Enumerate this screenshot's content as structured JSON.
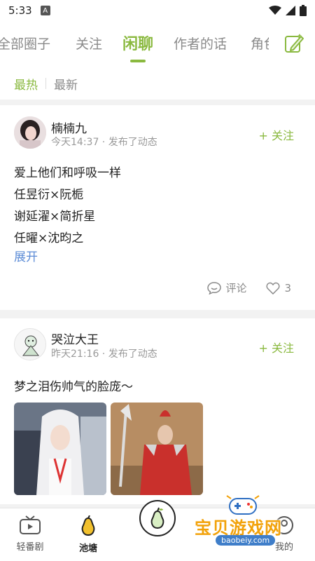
{
  "status_bar": {
    "time": "5:33",
    "badge": "A"
  },
  "tabs": [
    {
      "label": "全部圈子",
      "active": false
    },
    {
      "label": "关注",
      "active": false
    },
    {
      "label": "闲聊",
      "active": true
    },
    {
      "label": "作者的话",
      "active": false
    },
    {
      "label": "角色",
      "active": false
    }
  ],
  "subtabs": {
    "hot": "最热",
    "latest": "最新"
  },
  "posts": [
    {
      "username": "楠楠九",
      "meta": "今天14:37 · 发布了动态",
      "follow": "+ 关注",
      "lines": [
        "爱上他们和呼吸一样",
        "任昱衍×阮栀",
        "谢延濯×简折星",
        "任曜×沈昀之"
      ],
      "expand": "展开",
      "comment_label": "评论",
      "like_count": "3"
    },
    {
      "username": "哭泣大王",
      "meta": "昨天21:16 · 发布了动态",
      "follow": "+ 关注",
      "lines": [
        "梦之泪伤帅气的脸庞～"
      ]
    }
  ],
  "bottom_nav": {
    "items": [
      {
        "label": "轻番剧",
        "icon": "tv-icon"
      },
      {
        "label": "池塘",
        "icon": "pear-icon",
        "active": true
      },
      {
        "label": "",
        "icon": "pear-fab-icon"
      },
      {
        "label": "",
        "icon": ""
      },
      {
        "label": "我的",
        "icon": "profile-icon"
      }
    ]
  },
  "watermark": {
    "text": "宝贝游戏网",
    "url": "baobeiy.com"
  },
  "colors": {
    "accent": "#8ab93f",
    "link": "#5b8bd6",
    "watermark": "#f2a20a"
  }
}
